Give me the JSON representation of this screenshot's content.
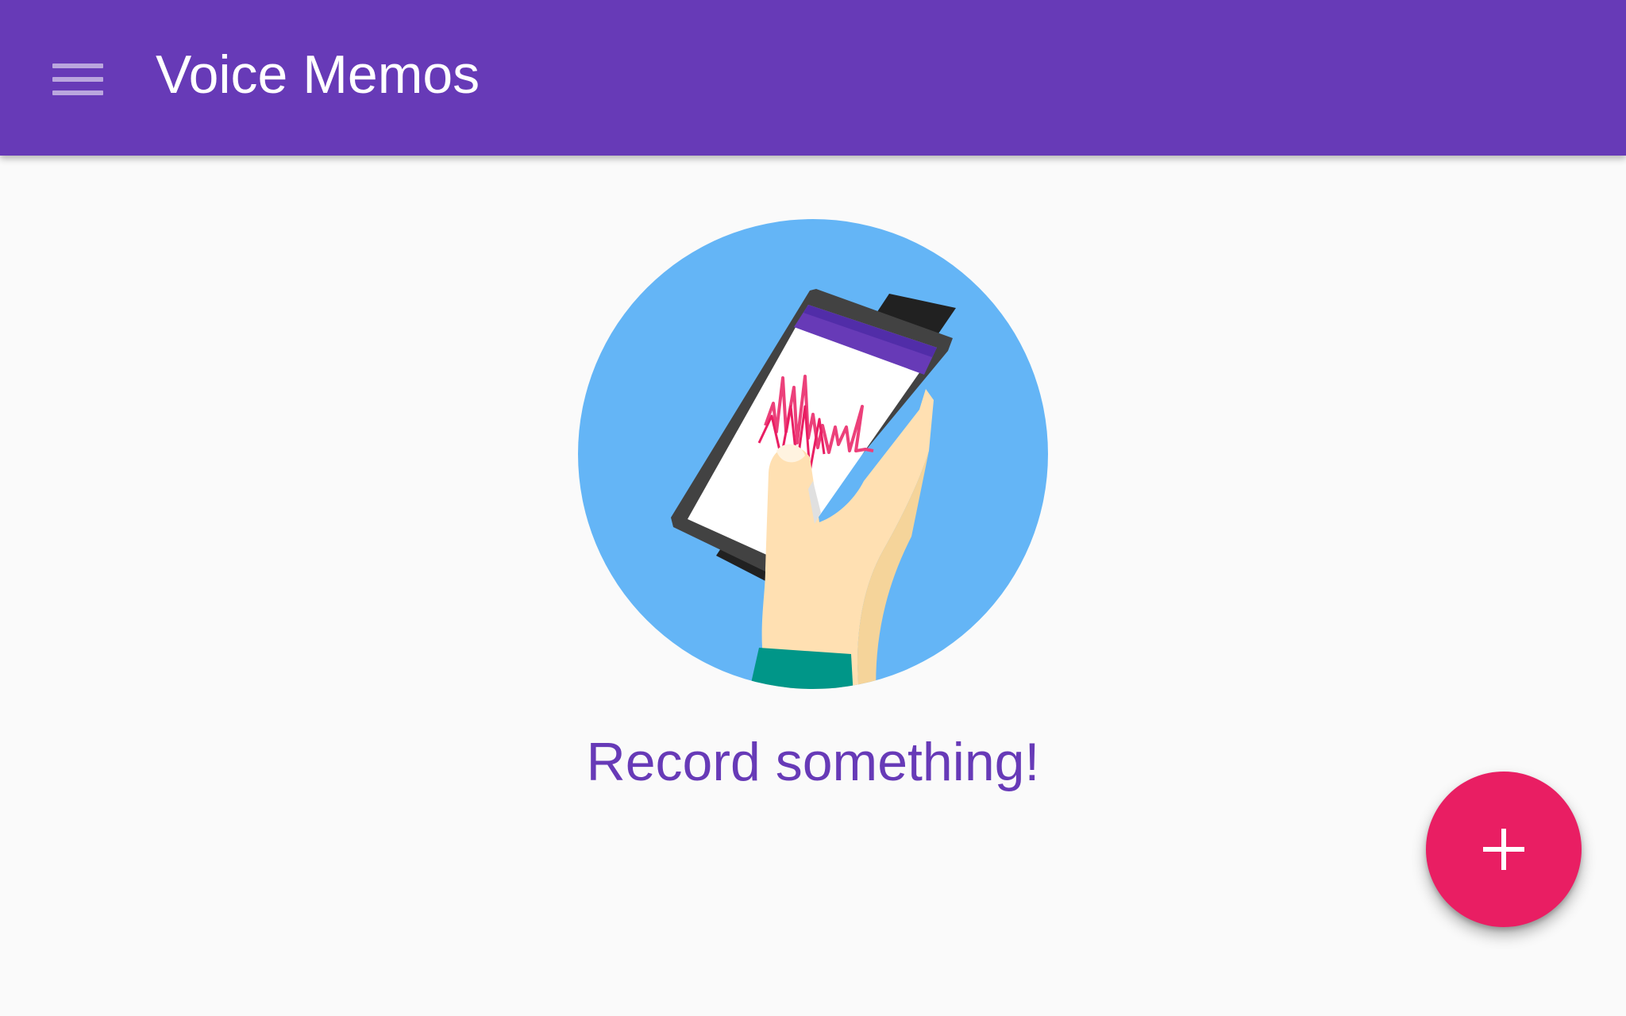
{
  "app": {
    "title": "Voice Memos"
  },
  "toolbar": {
    "menu_icon": "hamburger-menu-icon",
    "background_color": "#673AB7"
  },
  "empty_state": {
    "illustration": "hand-holding-phone-recording-illustration",
    "message": "Record something!",
    "message_color": "#673AB7",
    "circle_color": "#64B5F6"
  },
  "fab": {
    "icon": "plus-icon",
    "color": "#E91E63"
  }
}
